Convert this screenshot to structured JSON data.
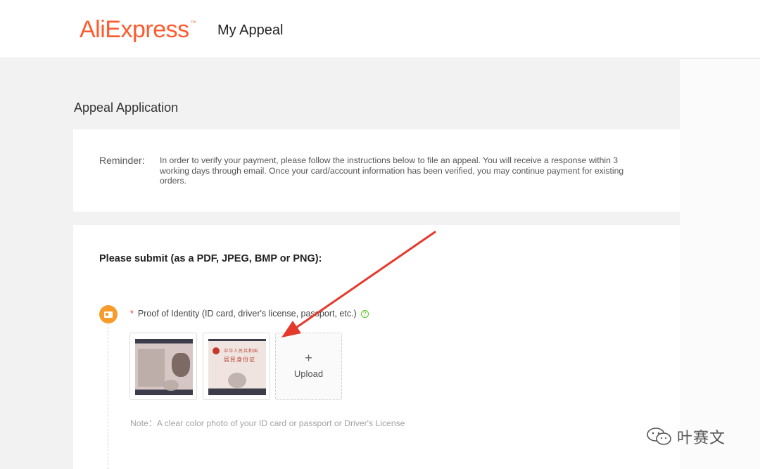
{
  "header": {
    "logo_text": "AliExpress",
    "logo_tm": "™",
    "title": "My Appeal"
  },
  "page": {
    "section_title": "Appeal Application"
  },
  "reminder": {
    "label": "Reminder:",
    "text": "In order to verify your payment, please follow the instructions below to file an appeal. You will receive a response within 3 working days through email. Once your card/account information has been verified, you may continue payment for existing orders."
  },
  "submission": {
    "heading": "Please submit (as a PDF, JPEG, BMP or PNG):",
    "field": {
      "required_mark": "*",
      "label": "Proof of Identity (ID card, driver's license, passport, etc.)",
      "help_symbol": "?"
    },
    "id_back_text_line1": "中华人民共和国",
    "id_back_text_line2": "居民身份证",
    "upload": {
      "plus": "+",
      "label": "Upload"
    },
    "note": "Note：A clear color photo of your ID card or passport or Driver's License"
  },
  "watermark": {
    "text": "叶赛文"
  },
  "colors": {
    "brand": "#ff5b2e",
    "step_badge": "#f79b2b",
    "arrow": "#e5392b",
    "required": "#ff3b30",
    "help": "#52c41a"
  }
}
